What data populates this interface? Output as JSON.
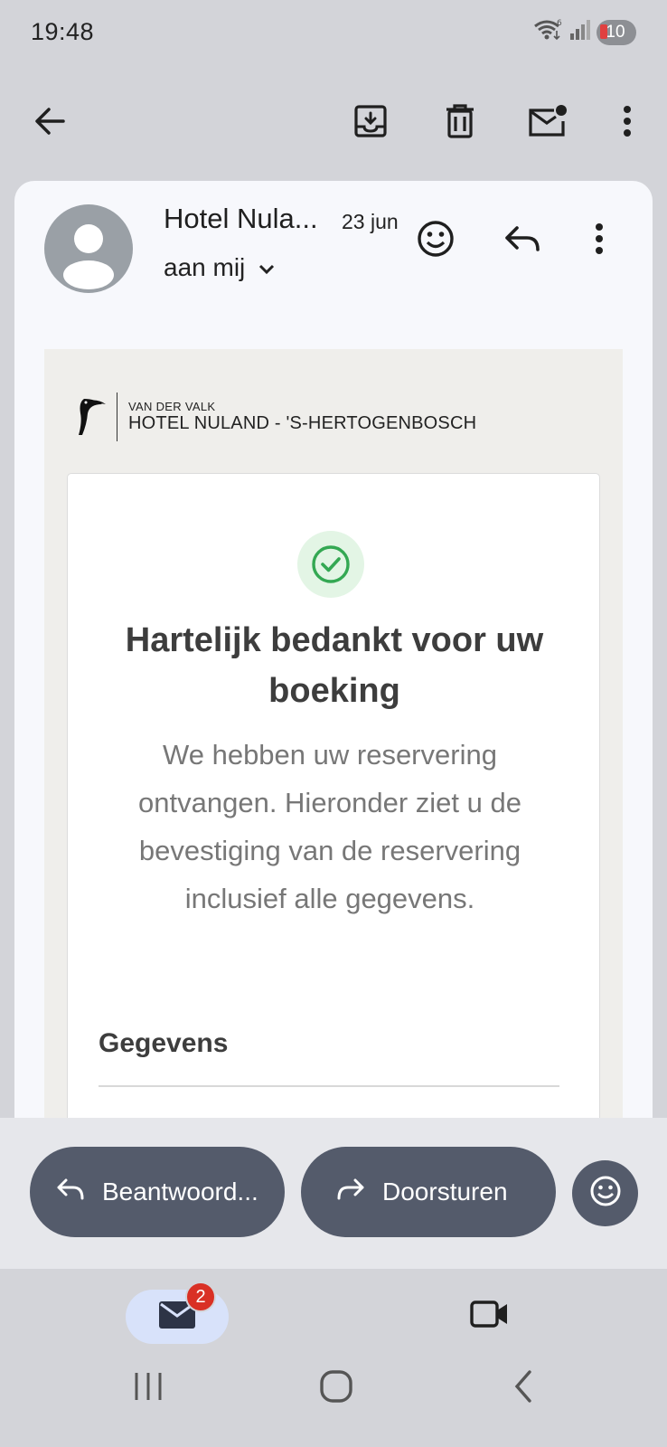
{
  "status_bar": {
    "time": "19:48",
    "battery_level": "10",
    "icons": [
      "wifi-6-icon",
      "signal-icon",
      "battery-icon"
    ]
  },
  "toolbar": {
    "icons": [
      "back-arrow-icon",
      "archive-icon",
      "delete-icon",
      "mark-unread-icon",
      "more-vert-icon"
    ]
  },
  "message": {
    "sender": "Hotel Nula...",
    "date": "23 jun",
    "recipient": "aan mij",
    "header_icons": [
      "add-reaction-icon",
      "reply-icon",
      "more-vert-icon"
    ]
  },
  "email": {
    "logo": {
      "small_text": "VAN DER VALK",
      "big_text": "HOTEL NULAND - 'S-HERTOGENBOSCH"
    },
    "headline": "Hartelijk bedankt voor uw boeking",
    "subtext": "We hebben uw reservering ontvangen. Hieronder ziet u de bevestiging van de reservering inclusief alle gegevens.",
    "section_title": "Gegevens"
  },
  "actions": {
    "reply_label": "Beantwoord...",
    "forward_label": "Doorsturen"
  },
  "bottom_nav": {
    "mail_badge": "2",
    "tabs": [
      "mail-icon",
      "video-call-icon"
    ]
  },
  "colors": {
    "pill_bg": "#545b6b",
    "check_green": "#34a853",
    "badge_red": "#d93025",
    "active_tab_bg": "#d8e2fa"
  }
}
